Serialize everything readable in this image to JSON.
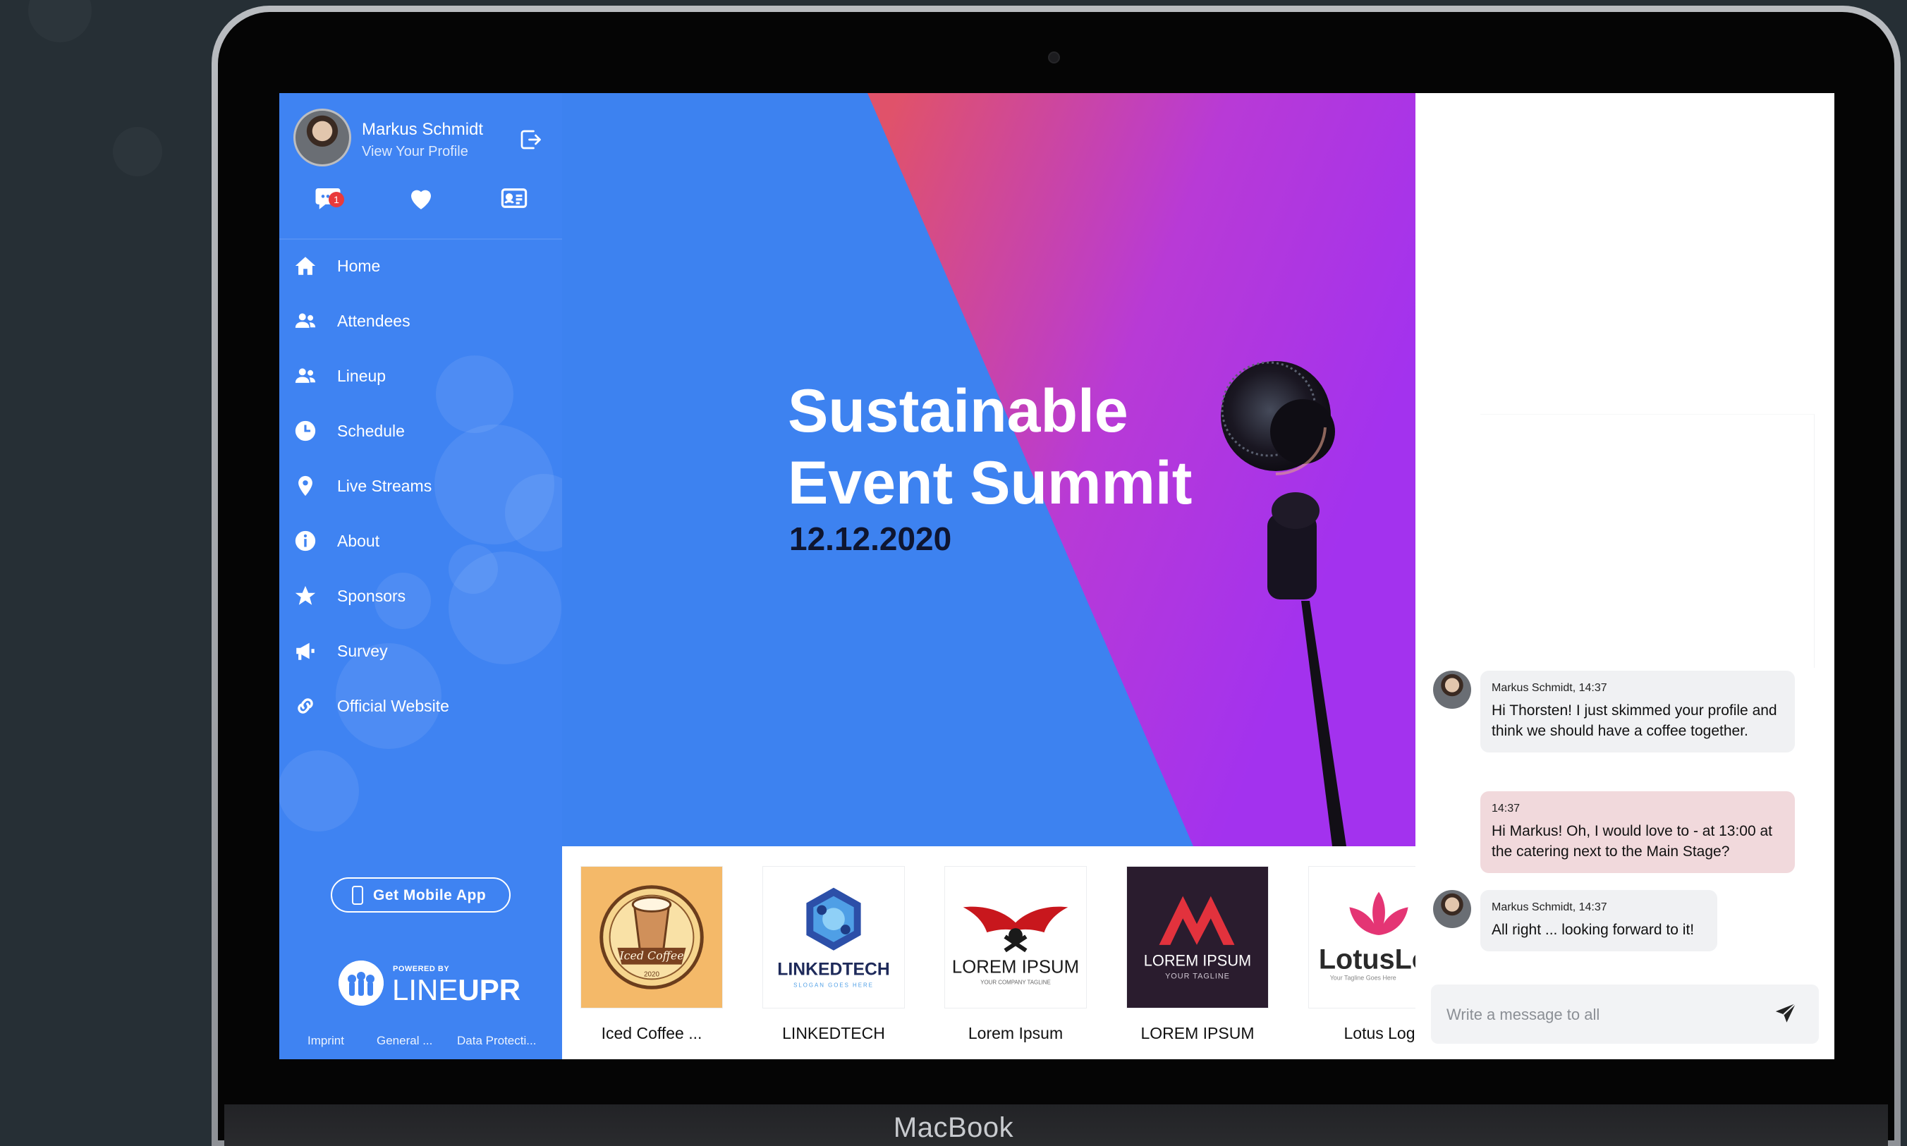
{
  "device": {
    "label": "MacBook"
  },
  "profile": {
    "name": "Markus Schmidt",
    "subtitle": "View Your Profile"
  },
  "quick_icons": [
    {
      "icon": "chat-bubble-icon",
      "badge": "1"
    },
    {
      "icon": "heart-icon"
    },
    {
      "icon": "contact-card-icon"
    }
  ],
  "nav": [
    {
      "label": "Home",
      "icon": "home-icon"
    },
    {
      "label": "Attendees",
      "icon": "people-icon"
    },
    {
      "label": "Lineup",
      "icon": "people-icon"
    },
    {
      "label": "Schedule",
      "icon": "clock-icon"
    },
    {
      "label": "Live Streams",
      "icon": "map-pin-icon"
    },
    {
      "label": "About",
      "icon": "info-icon"
    },
    {
      "label": "Sponsors",
      "icon": "star-icon"
    },
    {
      "label": "Survey",
      "icon": "megaphone-icon"
    },
    {
      "label": "Official Website",
      "icon": "link-icon"
    }
  ],
  "mobile_button": {
    "label": "Get Mobile App"
  },
  "powered_by": {
    "small": "POWERED BY",
    "brand_light": "LINE",
    "brand_bold": "UPR"
  },
  "footer_links": [
    "Imprint",
    "General ...",
    "Data Protecti..."
  ],
  "hero": {
    "title_line1": "Sustainable",
    "title_line2": "Event Summit",
    "date": "12.12.2020"
  },
  "sponsors": [
    {
      "name": "Iced Coffee ...",
      "logo_text": "Iced Coffee",
      "logo_sub": "2020"
    },
    {
      "name": "LINKEDTECH",
      "logo_text": "LINKEDTECH",
      "logo_sub": "SLOGAN GOES HERE"
    },
    {
      "name": "Lorem Ipsum",
      "logo_text": "LOREM IPSUM",
      "logo_sub": "YOUR COMPANY TAGLINE"
    },
    {
      "name": "LOREM IPSUM",
      "logo_text": "LOREM IPSUM",
      "logo_sub": "YOUR TAGLINE"
    },
    {
      "name": "Lotus Log",
      "logo_text": "LotusLo",
      "logo_sub": "Your Tagline Goes Here"
    }
  ],
  "chat": {
    "messages": [
      {
        "meta": "Markus Schmidt, 14:37",
        "text": "Hi Thorsten! I just skimmed your profile and think we should have a coffee together.",
        "mine": false
      },
      {
        "meta": "14:37",
        "text": "Hi Markus! Oh, I would love to - at 13:00 at the catering next to the Main Stage?",
        "mine": true
      },
      {
        "meta": "Markus Schmidt, 14:37",
        "text": "All right ... looking forward to it!",
        "mine": false
      }
    ],
    "input_placeholder": "Write a message to all"
  },
  "colors": {
    "sidebar": "#3f83f2",
    "hero_blue": "#3d82f0",
    "hero_pink": "#e0526a",
    "hero_purple": "#a332ee",
    "my_bubble": "#f1d9dc",
    "other_bubble": "#f0f1f3"
  }
}
